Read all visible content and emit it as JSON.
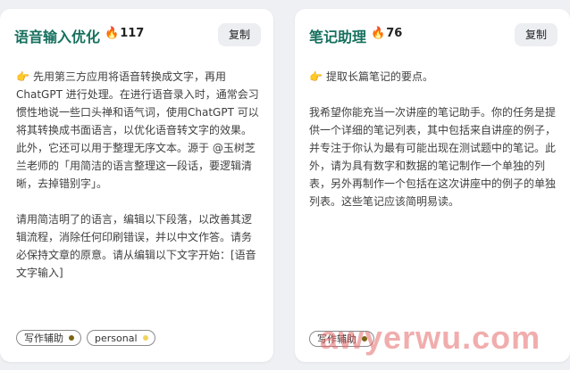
{
  "cards": [
    {
      "title": "语音输入优化",
      "count": "117",
      "copy_label": "复制",
      "paragraphs": [
        "先用第三方应用将语音转换成文字，再用ChatGPT 进行处理。在进行语音录入时，通常会习惯性地说一些口头禅和语气词，使用ChatGPT 可以将其转换成书面语言，以优化语音转文字的效果。此外，它还可以用于整理无序文本。源于 @玉树芝兰老师的「用简洁的语言整理这一段话，要逻辑清晰，去掉错别字」。",
        "请用简洁明了的语言，编辑以下段落，以改善其逻辑流程，消除任何印刷错误，并以中文作答。请务必保持文章的原意。请从编辑以下文字开始：[语音文字输入]"
      ],
      "tags": [
        {
          "label": "写作辅助",
          "color": "#7a6415"
        },
        {
          "label": "personal",
          "color": "#f2d35c"
        }
      ]
    },
    {
      "title": "笔记助理",
      "count": "76",
      "copy_label": "复制",
      "paragraphs": [
        "提取长篇笔记的要点。",
        "我希望你能充当一次讲座的笔记助手。你的任务是提供一个详细的笔记列表，其中包括来自讲座的例子，并专注于你认为最有可能出现在测试题中的笔记。此外，请为具有数字和数据的笔记制作一个单独的列表，另外再制作一个包括在这次讲座中的例子的单独列表。这些笔记应该简明易读。"
      ],
      "tags": [
        {
          "label": "写作辅助",
          "color": "#7a6415"
        }
      ]
    }
  ],
  "watermark": "awyerwu.com",
  "colors": {
    "title": "#16705e",
    "fire": "#f06c1a",
    "hand": "#e8a317",
    "background": "#eef0f4"
  },
  "icons": {
    "count": "fire-icon",
    "lead": "pointing-hand-icon"
  }
}
